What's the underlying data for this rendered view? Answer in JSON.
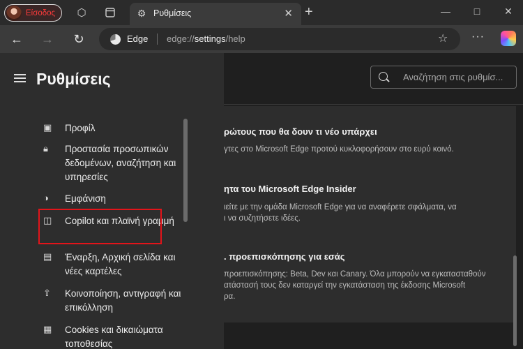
{
  "browser": {
    "profile_label": "Είσοδος",
    "tab_title": "Ρυθμίσεις",
    "edge_label": "Edge",
    "url_prefix": "edge://",
    "url_highlight": "settings",
    "url_suffix": "/help"
  },
  "settings": {
    "title": "Ρυθμίσεις",
    "search_placeholder": "Αναζήτηση στις ρυθμίσ...",
    "menu": [
      {
        "label": "Προφίλ",
        "icon": "profile-icon"
      },
      {
        "label": "Προστασία προσωπικών δεδομένων, αναζήτηση και υπηρεσίες",
        "icon": "lock-icon"
      },
      {
        "label": "Εμφάνιση",
        "icon": "palette-icon"
      },
      {
        "label": "Copilot και πλαϊνή γραμμή",
        "icon": "sidebar-icon"
      },
      {
        "label": "Έναρξη, Αρχική σελίδα και νέες καρτέλες",
        "icon": "home-tab-icon"
      },
      {
        "label": "Κοινοποίηση, αντιγραφή και επικόλληση",
        "icon": "share-icon"
      },
      {
        "label": "Cookies και δικαιώματα τοποθεσίας",
        "icon": "cookies-icon"
      }
    ]
  },
  "content": {
    "sections": [
      {
        "title": "ρώτους που θα δουν τι νέο υπάρχει",
        "lines": [
          "γτες στο Microsoft Edge προτού κυκλοφορήσουν στο ευρύ κοινό."
        ]
      },
      {
        "title": "ητα του Microsoft Edge Insider",
        "lines": [
          "ιείτε με την ομάδα Microsoft Edge για να αναφέρετε σφάλματα, να",
          "ι να συζητήσετε ιδέες."
        ]
      },
      {
        "title": ". προεπισκόπησης για εσάς",
        "lines": [
          "προεπισκόπησης: Beta, Dev και Canary. Όλα μπορούν να εγκατασταθούν",
          "ατάστασή τους δεν καταργεί την εγκατάσταση της έκδοσης Microsoft",
          "ρα."
        ]
      }
    ]
  }
}
